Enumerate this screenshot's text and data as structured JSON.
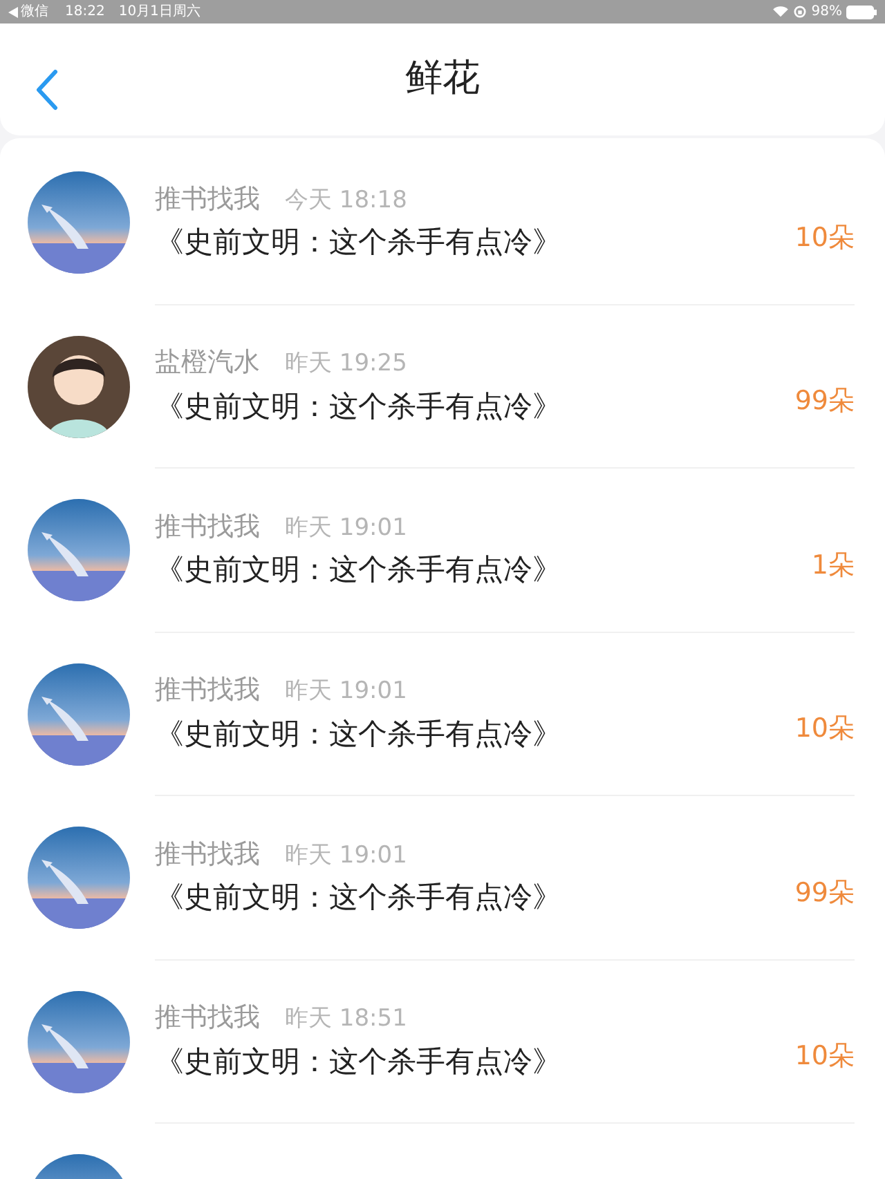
{
  "status_bar": {
    "app": "微信",
    "time": "18:22",
    "date": "10月1日周六",
    "battery": "98%"
  },
  "header": {
    "title": "鲜花"
  },
  "items": [
    {
      "kind": "picture",
      "name": "推书找我",
      "time": "今天 18:18",
      "book": "《史前文明：这个杀手有点冷》",
      "amount": "10朵"
    },
    {
      "kind": "person",
      "name": "盐橙汽水",
      "time": "昨天 19:25",
      "book": "《史前文明：这个杀手有点冷》",
      "amount": "99朵"
    },
    {
      "kind": "picture",
      "name": "推书找我",
      "time": "昨天 19:01",
      "book": "《史前文明：这个杀手有点冷》",
      "amount": "1朵"
    },
    {
      "kind": "picture",
      "name": "推书找我",
      "time": "昨天 19:01",
      "book": "《史前文明：这个杀手有点冷》",
      "amount": "10朵"
    },
    {
      "kind": "picture",
      "name": "推书找我",
      "time": "昨天 19:01",
      "book": "《史前文明：这个杀手有点冷》",
      "amount": "99朵"
    },
    {
      "kind": "picture",
      "name": "推书找我",
      "time": "昨天 18:51",
      "book": "《史前文明：这个杀手有点冷》",
      "amount": "10朵"
    },
    {
      "kind": "picture"
    }
  ]
}
